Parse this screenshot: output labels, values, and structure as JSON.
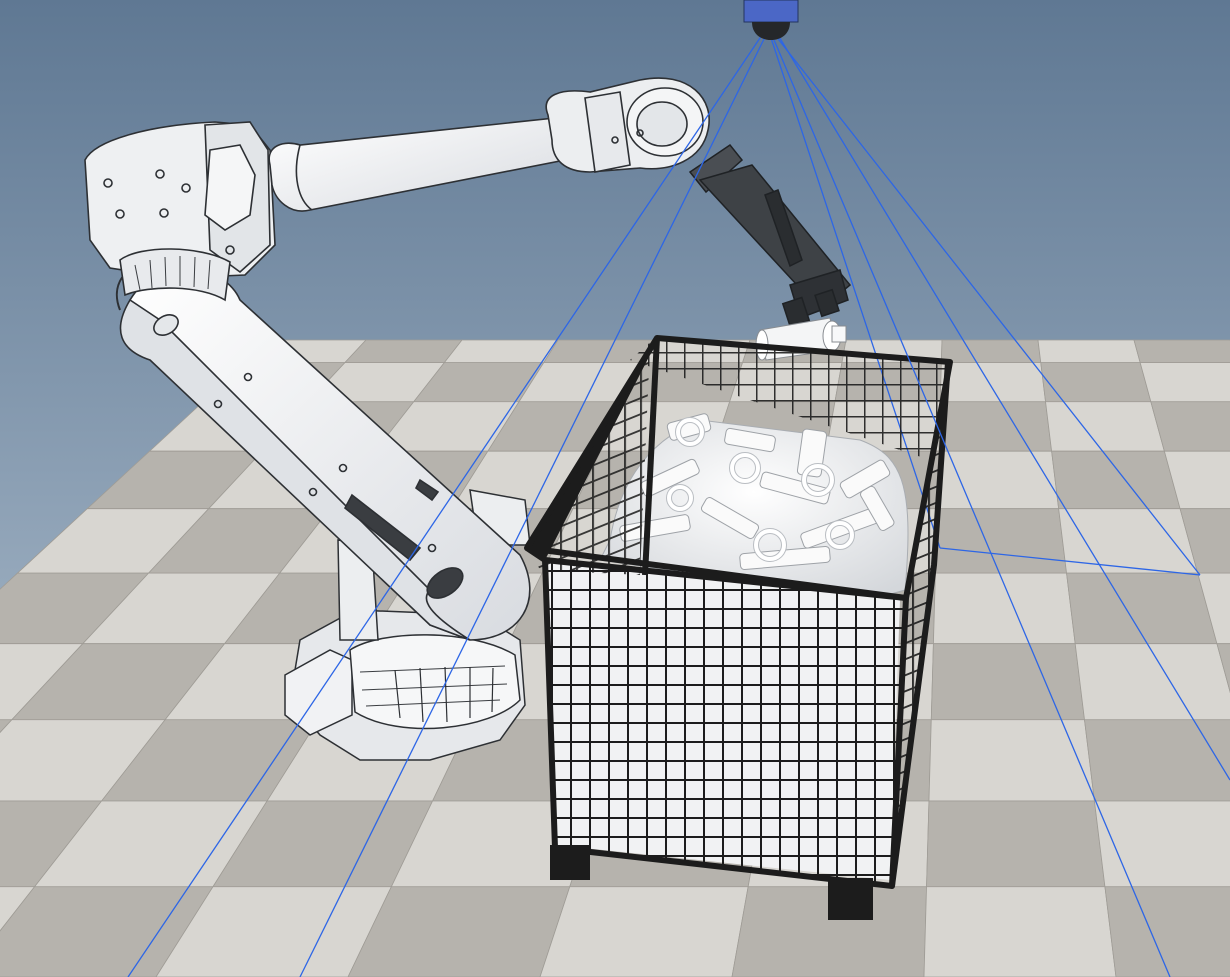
{
  "scene": {
    "background": {
      "sky_top": "#5f7893",
      "sky_bottom": "#b9c8d6"
    },
    "floor": {
      "tile_light": "#d8d6d1",
      "tile_dark": "#b6b3ad",
      "grout": "#9f9c96"
    },
    "robot": {
      "body_color": "#e9ebee",
      "line_color": "#2d3034",
      "tool_color": "#3e4246"
    },
    "bin": {
      "frame_color": "#1c1c1c",
      "parts_color": "#f2f3f4"
    },
    "camera": {
      "body_color": "#4b67c6",
      "frustum_color": "#2d66e6"
    }
  }
}
